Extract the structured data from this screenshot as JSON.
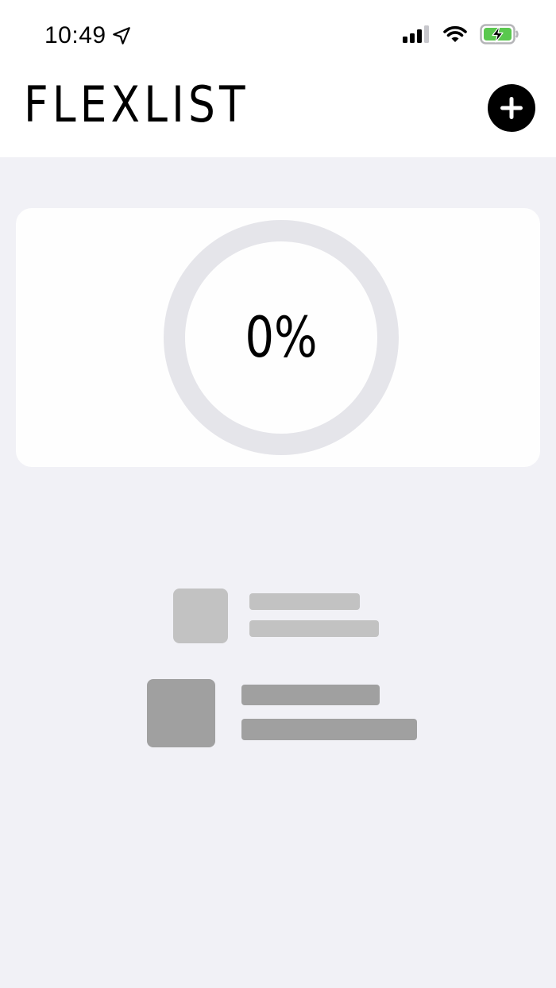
{
  "status_bar": {
    "time": "10:49",
    "location_icon": "location-arrow-icon",
    "signal_icon": "cellular-signal-icon",
    "wifi_icon": "wifi-icon",
    "battery_icon": "battery-charging-icon"
  },
  "header": {
    "title": "FLEXLIST",
    "add_icon": "plus-icon"
  },
  "progress": {
    "label": "0%",
    "value": 0
  },
  "empty_state": {
    "icon": "empty-list-placeholder-icon"
  },
  "colors": {
    "background": "#f1f1f6",
    "card": "#fefefe",
    "ring_track": "#e5e5ea",
    "placeholder_light": "#c2c2c2",
    "placeholder_dark": "#a0a0a0",
    "accent": "#000000",
    "battery_charge": "#5ac84e"
  }
}
